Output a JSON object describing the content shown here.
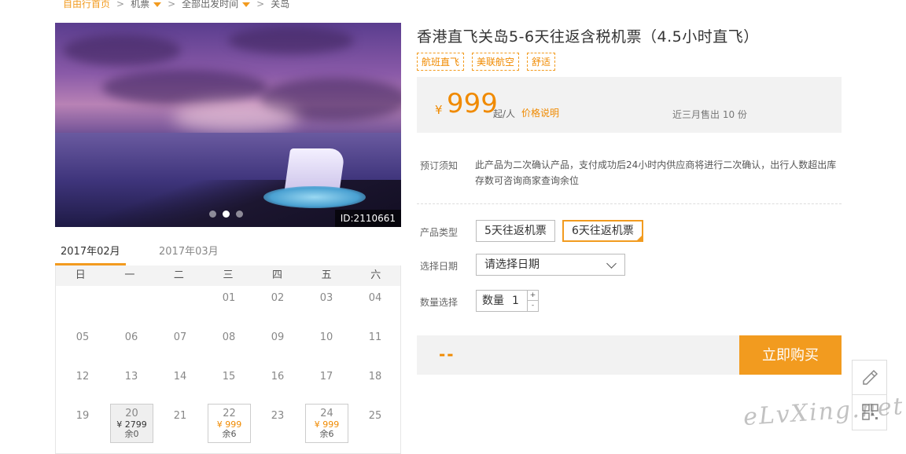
{
  "breadcrumb": {
    "home": "自由行首页",
    "items": [
      "机票",
      "全部出发时间",
      "关岛"
    ],
    "sep": ">"
  },
  "gallery": {
    "id_tag": "ID:2110661",
    "dots": 3,
    "active_dot": 1
  },
  "calendar": {
    "months": [
      "2017年02月",
      "2017年03月"
    ],
    "active_month": 0,
    "weekdays": [
      "日",
      "一",
      "二",
      "三",
      "四",
      "五",
      "六"
    ],
    "weeks": [
      [
        {
          "d": ""
        },
        {
          "d": ""
        },
        {
          "d": ""
        },
        {
          "d": "01"
        },
        {
          "d": "02"
        },
        {
          "d": "03"
        },
        {
          "d": "04"
        }
      ],
      [
        {
          "d": "05"
        },
        {
          "d": "06"
        },
        {
          "d": "07"
        },
        {
          "d": "08"
        },
        {
          "d": "09"
        },
        {
          "d": "10"
        },
        {
          "d": "11"
        }
      ],
      [
        {
          "d": "12"
        },
        {
          "d": "13"
        },
        {
          "d": "14"
        },
        {
          "d": "15"
        },
        {
          "d": "16"
        },
        {
          "d": "17"
        },
        {
          "d": "18"
        }
      ],
      [
        {
          "d": "19"
        },
        {
          "d": "20",
          "price": "¥ 2799",
          "remain": "余0",
          "soldout": true
        },
        {
          "d": "21"
        },
        {
          "d": "22",
          "price": "¥ 999",
          "remain": "余6"
        },
        {
          "d": "23"
        },
        {
          "d": "24",
          "price": "¥ 999",
          "remain": "余6"
        },
        {
          "d": "25"
        }
      ]
    ]
  },
  "product": {
    "title": "香港直飞关岛5-6天往返含税机票（4.5小时直飞）",
    "tags": [
      "航班直飞",
      "美联航空",
      "舒适"
    ]
  },
  "price": {
    "currency": "¥",
    "amount": "999",
    "unit": "起/人",
    "link": "价格说明",
    "sold": "近三月售出 10 份"
  },
  "notice": {
    "label": "预订须知",
    "text": "此产品为二次确认产品，支付成功后24小时内供应商将进行二次确认，出行人数超出库存数可咨询商家查询余位"
  },
  "options": {
    "type_label": "产品类型",
    "types": [
      "5天往返机票",
      "6天往返机票"
    ],
    "selected_type": 1,
    "date_label": "选择日期",
    "date_placeholder": "请选择日期",
    "qty_label": "数量选择",
    "qty_prefix": "数量",
    "qty_value": "1",
    "plus": "+",
    "minus": "-"
  },
  "buy": {
    "total": "--",
    "button": "立即购买"
  },
  "sidebar_tools": [
    "edit-icon",
    "qrcode-icon"
  ],
  "watermark": "eLvXing.net",
  "colors": {
    "accent": "#f29b1f",
    "price": "#f08a00"
  }
}
